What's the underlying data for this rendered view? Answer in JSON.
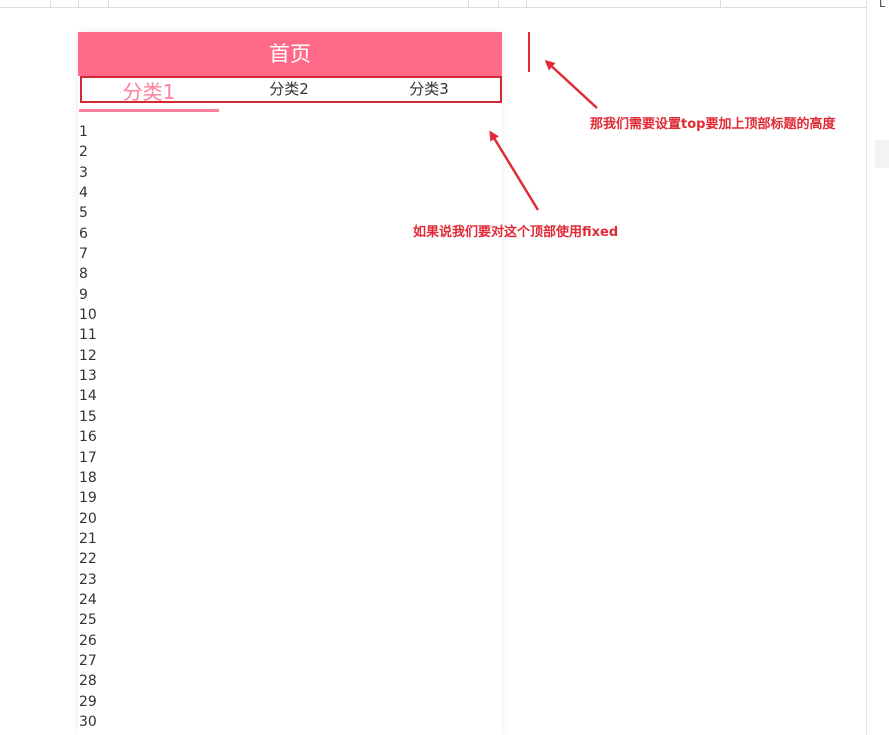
{
  "header": {
    "title": "首页"
  },
  "tabs": [
    {
      "label": "分类1",
      "active": true
    },
    {
      "label": "分类2",
      "active": false
    },
    {
      "label": "分类3",
      "active": false
    }
  ],
  "list_items": [
    "1",
    "2",
    "3",
    "4",
    "5",
    "6",
    "7",
    "8",
    "9",
    "10",
    "11",
    "12",
    "13",
    "14",
    "15",
    "16",
    "17",
    "18",
    "19",
    "20",
    "21",
    "22",
    "23",
    "24",
    "25",
    "26",
    "27",
    "28",
    "29",
    "30"
  ],
  "annotations": {
    "fixed_note": "如果说我们要对这个顶部使用fixed",
    "top_note": "那我们需要设置top要加上顶部标题的高度"
  },
  "colors": {
    "header_bg": "#ff6a88",
    "active_tab": "#ff7f9c",
    "annotation_red": "#e02a36"
  }
}
